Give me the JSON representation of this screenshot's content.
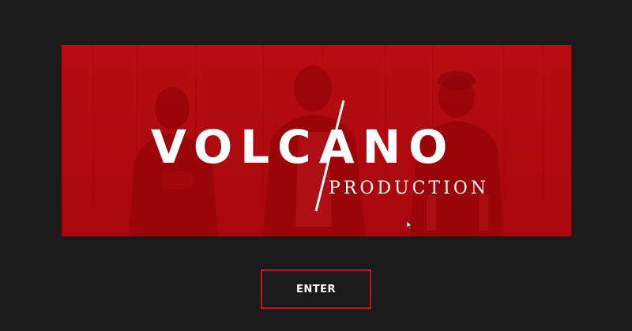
{
  "hero": {
    "brand_word": "VOLCANO",
    "brand_subtitle": "PRODUCTION"
  },
  "enter_button": {
    "label": "ENTER"
  },
  "colors": {
    "background": "#1b1b1b",
    "brand_red": "#b30a0f",
    "button_border": "#c4121a",
    "text": "#ffffff"
  }
}
